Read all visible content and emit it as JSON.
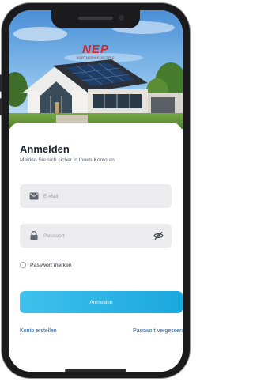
{
  "brand": {
    "logo_text": "NEP",
    "tagline": "NORTHERN ELECTRIC"
  },
  "login": {
    "title": "Anmelden",
    "subtitle": "Melden Sie sich sicher in Ihrem Konto an",
    "email_placeholder": "E-Mail",
    "password_placeholder": "Passwort",
    "remember_label": "Passwort merken",
    "submit_label": "Anmelden",
    "create_account_label": "Konto erstellen",
    "forgot_password_label": "Passwort vergessen"
  },
  "icons": {
    "email": "mail-icon",
    "password": "lock-icon",
    "toggle_password": "eye-off-icon"
  },
  "colors": {
    "accent": "#1aa8dd",
    "brand": "#d8262b",
    "link": "#1c5fa8"
  }
}
